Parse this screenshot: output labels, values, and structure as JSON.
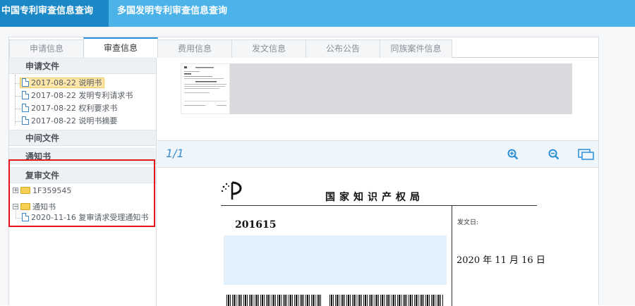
{
  "top_nav": {
    "tab1": "中国专利审查信息查询",
    "tab2": "多国发明专利审查信息查询"
  },
  "tabs": [
    "申请信息",
    "审查信息",
    "费用信息",
    "发文信息",
    "公布公告",
    "同族案件信息"
  ],
  "active_tab": "审查信息",
  "sidebar": {
    "section_application": "申请文件",
    "application_files": [
      "2017-08-22 说明书",
      "2017-08-22 发明专利请求书",
      "2017-08-22 权利要求书",
      "2017-08-22 说明书摘要"
    ],
    "section_intermediate": "中间文件",
    "section_notice": "通知书",
    "section_reexam": "复审文件",
    "reexam_folders": [
      "1F359545",
      "通知书"
    ],
    "reexam_doc": "2020-11-16 复审请求受理通知书"
  },
  "viewer": {
    "page_indicator": "1/1",
    "tools": [
      "zoom-in-icon",
      "zoom-out-icon",
      "fullscreen-icon"
    ]
  },
  "document": {
    "office_title": "国家知识产权局",
    "number": "201615",
    "send_date_label": "发文日:",
    "send_date": "2020 年 11 月 16 日"
  },
  "colors": {
    "top_bar": "#4bb3e8",
    "top_tab_active": "#1a88c6",
    "highlight_box": "#e2161b",
    "accent": "#3d8fd0"
  }
}
